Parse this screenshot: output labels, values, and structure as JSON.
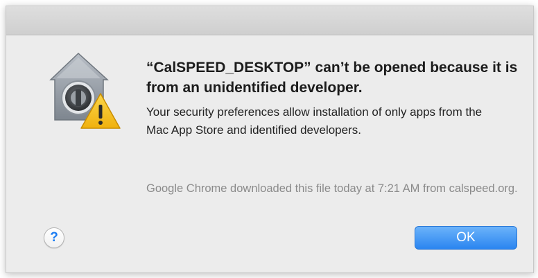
{
  "dialog": {
    "title": "“CalSPEED_DESKTOP” can’t be opened because it is from an unidentified developer.",
    "message": "Your security preferences allow installation of only apps from the Mac App Store and identified developers.",
    "note": "Google Chrome downloaded this file today at 7:21 AM from calspeed.org.",
    "icon": "gatekeeper-warning-icon"
  },
  "buttons": {
    "help_label": "?",
    "ok_label": "OK"
  },
  "colors": {
    "accent": "#2a85f0",
    "warning": "#f7c21a",
    "dialog_bg": "#ececec"
  }
}
